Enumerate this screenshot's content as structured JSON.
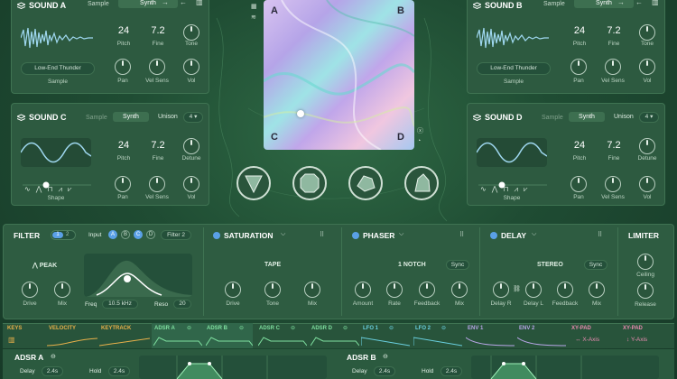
{
  "soundA": {
    "title": "SOUND A",
    "tab_sample": "Sample",
    "tab_synth": "Synth",
    "pitch": "24",
    "pitch_label": "Pitch",
    "fine": "7.2",
    "fine_label": "Fine",
    "tone_label": "Tone",
    "sample_name": "Low-End Thunder",
    "sample_label": "Sample",
    "pan": "Pan",
    "vel": "Vel Sens",
    "vol": "Vol"
  },
  "soundB": {
    "title": "SOUND B",
    "tab_sample": "Sample",
    "tab_synth": "Synth",
    "pitch": "24",
    "pitch_label": "Pitch",
    "fine": "7.2",
    "fine_label": "Fine",
    "tone_label": "Tone",
    "sample_name": "Low-End Thunder",
    "sample_label": "Sample",
    "pan": "Pan",
    "vel": "Vel Sens",
    "vol": "Vol"
  },
  "soundC": {
    "title": "SOUND C",
    "tab_sample": "Sample",
    "tab_synth": "Synth",
    "unison_label": "Unison",
    "unison_value": "4",
    "pitch": "24",
    "pitch_label": "Pitch",
    "fine": "7.2",
    "fine_label": "Fine",
    "detune_label": "Detune",
    "shape_label": "Shape",
    "pan": "Pan",
    "vel": "Vel Sens",
    "vol": "Vol"
  },
  "soundD": {
    "title": "SOUND D",
    "tab_sample": "Sample",
    "tab_synth": "Synth",
    "unison_label": "Unison",
    "unison_value": "4",
    "pitch": "24",
    "pitch_label": "Pitch",
    "fine": "7.2",
    "fine_label": "Fine",
    "detune_label": "Detune",
    "shape_label": "Shape",
    "pan": "Pan",
    "vel": "Vel Sens",
    "vol": "Vol"
  },
  "xy": {
    "a": "A",
    "b": "B",
    "c": "C",
    "d": "D"
  },
  "filter": {
    "title": "FILTER",
    "mode1": "1",
    "mode2": "2",
    "input_label": "Input",
    "inputs": [
      "A",
      "B",
      "C",
      "D"
    ],
    "preset": "Filter 2",
    "type": "PEAK",
    "drive": "Drive",
    "mix": "Mix",
    "freq": "Freq",
    "freq_value": "10.5 kHz",
    "reso": "Reso",
    "reso_value": "20"
  },
  "saturation": {
    "title": "SATURATION",
    "type": "TAPE",
    "drive": "Drive",
    "tone": "Tone",
    "mix": "Mix"
  },
  "phaser": {
    "title": "PHASER",
    "type": "1 NOTCH",
    "sync": "Sync",
    "amount": "Amount",
    "rate": "Rate",
    "feedback": "Feedback",
    "mix": "Mix"
  },
  "delay": {
    "title": "DELAY",
    "type": "STEREO",
    "sync": "Sync",
    "delay_r": "Delay R",
    "delay_l": "Delay L",
    "feedback": "Feedback",
    "mix": "Mix"
  },
  "limiter": {
    "title": "LIMITER",
    "ceiling": "Ceiling",
    "release": "Release"
  },
  "mod": {
    "keys": "KEYS",
    "velocity": "VELOCITY",
    "keytrack": "KEYTRACK",
    "adsr_a": "ADSR A",
    "adsr_b": "ADSR B",
    "adsr_c": "ADSR C",
    "adsr_d": "ADSR D",
    "lfo1": "LFO 1",
    "lfo2": "LFO 2",
    "env1": "ENV 1",
    "env2": "ENV 2",
    "xypad1": "XY-PAD",
    "xypad2": "XY-PAD",
    "xaxis": "X-Axis",
    "yaxis": "Y-Axis"
  },
  "adsrA": {
    "title": "ADSR A",
    "delay_label": "Delay",
    "delay_value": "2.4s",
    "hold_label": "Hold",
    "hold_value": "2.4s"
  },
  "adsrB": {
    "title": "ADSR B",
    "delay_label": "Delay",
    "delay_value": "2.4s",
    "hold_label": "Hold",
    "hold_value": "2.4s"
  },
  "colors": {
    "accent_blue": "#5aa0e6",
    "keys": "#e8b04a",
    "adsr": "#7fe0a0",
    "lfo": "#6ad0e0",
    "env": "#b9a6e8",
    "xy": "#e88ab0"
  }
}
